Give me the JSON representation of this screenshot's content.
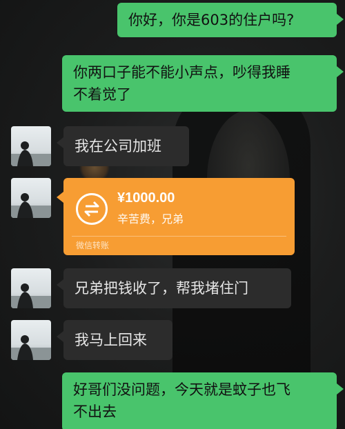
{
  "messages": {
    "sent_1": "你好，你是603的住户吗?",
    "sent_2_line1": "你两口子能不能小声点，吵得我睡",
    "sent_2_line2": "不着觉了",
    "recv_1": "我在公司加班",
    "recv_2": "兄弟把钱收了，帮我堵住门",
    "recv_3": "我马上回来",
    "sent_3_line1": "好哥们没问题，今天就是蚊子也飞",
    "sent_3_line2": "不出去"
  },
  "transfer": {
    "amount": "¥1000.00",
    "note": "辛苦费，兄弟",
    "source": "微信转账",
    "icon": "transfer-arrows-icon"
  },
  "colors": {
    "sent_bubble": "#49c46c",
    "recv_bubble": "#2c2c2c",
    "transfer_card": "#f79d33",
    "background": "#17191a"
  }
}
